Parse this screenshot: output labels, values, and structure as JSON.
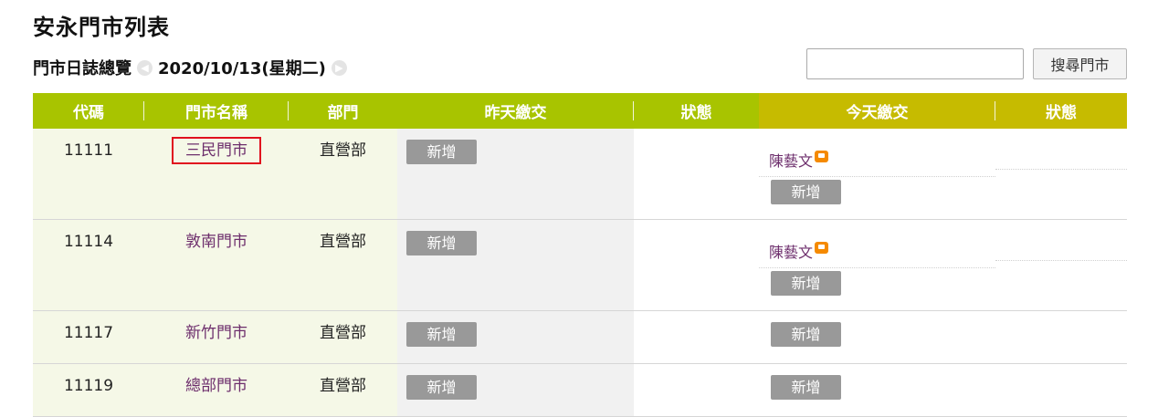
{
  "page": {
    "title": "安永門市列表"
  },
  "subheader": {
    "label": "門市日誌總覽",
    "prev_icon": "chevron-left-icon",
    "date": "2020/10/13(星期二)",
    "next_icon": "chevron-right-icon"
  },
  "search": {
    "value": "",
    "placeholder": "",
    "button_label": "搜尋門市"
  },
  "colors": {
    "header_green": "#a8c400",
    "header_olive": "#c6bb00",
    "link": "#6d2e6c",
    "button_gray": "#999999",
    "highlight_border": "#e0101e",
    "note_icon": "#f58a00"
  },
  "table": {
    "headers": [
      "代碼",
      "門市名稱",
      "部門",
      "昨天繳交",
      "狀態",
      "今天繳交",
      "狀態"
    ],
    "rows": [
      {
        "code": "11111",
        "name": "三民門市",
        "dept": "直營部",
        "yesterday_btn": "新增",
        "today_person": "陳藝文",
        "today_btn": "新增"
      },
      {
        "code": "11114",
        "name": "敦南門市",
        "dept": "直營部",
        "yesterday_btn": "新增",
        "today_person": "陳藝文",
        "today_btn": "新增"
      },
      {
        "code": "11117",
        "name": "新竹門市",
        "dept": "直營部",
        "yesterday_btn": "新增",
        "today_btn": "新增"
      },
      {
        "code": "11119",
        "name": "總部門市",
        "dept": "直營部",
        "yesterday_btn": "新增",
        "today_btn": "新增"
      }
    ]
  }
}
